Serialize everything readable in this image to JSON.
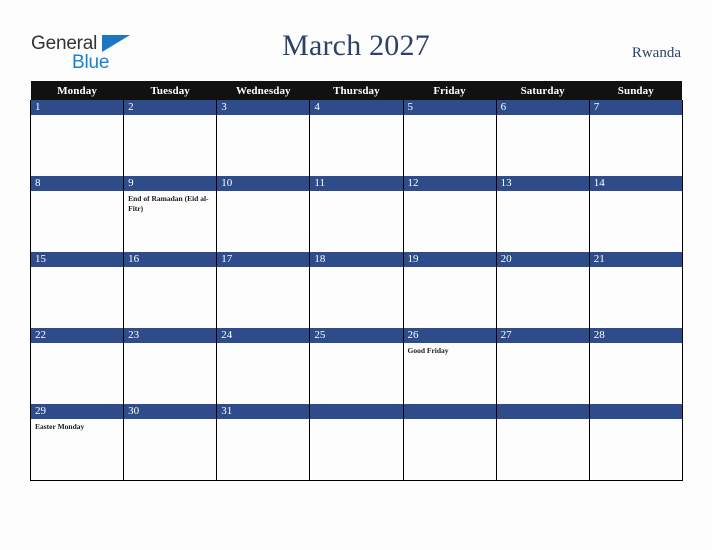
{
  "brand": {
    "line1": "General",
    "line2": "Blue",
    "triangle_color": "#1C77C3",
    "line1_color": "#333333",
    "line2_color": "#1B7FD4"
  },
  "header": {
    "title": "March 2027",
    "country": "Rwanda",
    "title_color": "#2C4268"
  },
  "theme": {
    "header_row_bg": "#111111",
    "date_bar_bg": "#2E4C8A",
    "date_text": "#FFFFFF",
    "page_bg": "#FDFDFD",
    "grid_line": "#000000",
    "event_text": "#1A1A1A"
  },
  "calendar": {
    "weekday_headers": [
      "Monday",
      "Tuesday",
      "Wednesday",
      "Thursday",
      "Friday",
      "Saturday",
      "Sunday"
    ],
    "weeks": [
      [
        {
          "date": "1",
          "events": []
        },
        {
          "date": "2",
          "events": []
        },
        {
          "date": "3",
          "events": []
        },
        {
          "date": "4",
          "events": []
        },
        {
          "date": "5",
          "events": []
        },
        {
          "date": "6",
          "events": []
        },
        {
          "date": "7",
          "events": []
        }
      ],
      [
        {
          "date": "8",
          "events": []
        },
        {
          "date": "9",
          "events": [
            "End of Ramadan (Eid al-Fitr)"
          ]
        },
        {
          "date": "10",
          "events": []
        },
        {
          "date": "11",
          "events": []
        },
        {
          "date": "12",
          "events": []
        },
        {
          "date": "13",
          "events": []
        },
        {
          "date": "14",
          "events": []
        }
      ],
      [
        {
          "date": "15",
          "events": []
        },
        {
          "date": "16",
          "events": []
        },
        {
          "date": "17",
          "events": []
        },
        {
          "date": "18",
          "events": []
        },
        {
          "date": "19",
          "events": []
        },
        {
          "date": "20",
          "events": []
        },
        {
          "date": "21",
          "events": []
        }
      ],
      [
        {
          "date": "22",
          "events": []
        },
        {
          "date": "23",
          "events": []
        },
        {
          "date": "24",
          "events": []
        },
        {
          "date": "25",
          "events": []
        },
        {
          "date": "26",
          "events": [
            "Good Friday"
          ]
        },
        {
          "date": "27",
          "events": []
        },
        {
          "date": "28",
          "events": []
        }
      ],
      [
        {
          "date": "29",
          "events": [
            "Easter Monday"
          ]
        },
        {
          "date": "30",
          "events": []
        },
        {
          "date": "31",
          "events": []
        },
        {
          "date": "",
          "events": []
        },
        {
          "date": "",
          "events": []
        },
        {
          "date": "",
          "events": []
        },
        {
          "date": "",
          "events": []
        }
      ]
    ]
  }
}
